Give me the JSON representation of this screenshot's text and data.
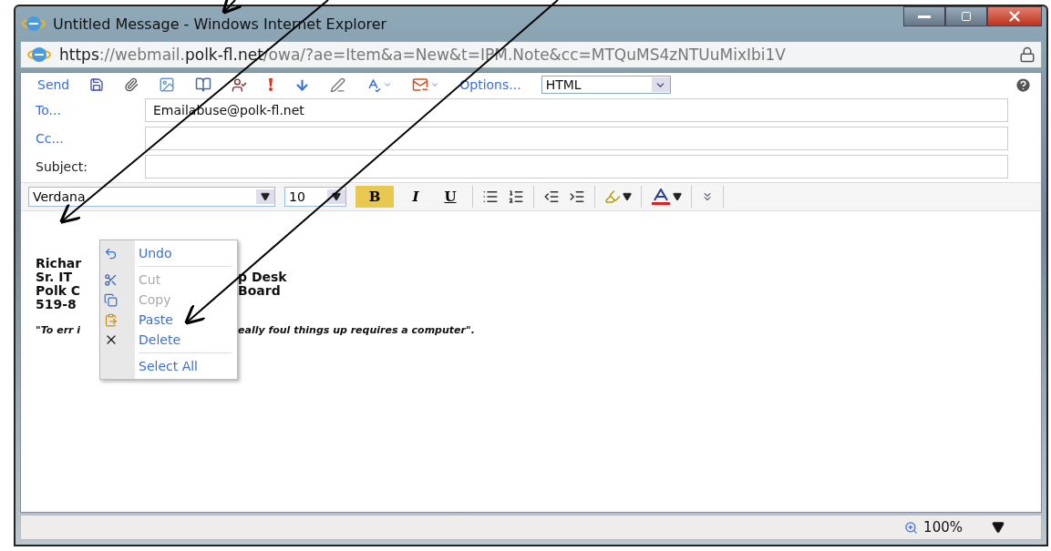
{
  "window": {
    "title": "Untitled Message - Windows Internet Explorer"
  },
  "address_bar": {
    "url_parts": [
      {
        "text": "https",
        "emphasis": true
      },
      {
        "text": "://webmail.",
        "emphasis": false
      },
      {
        "text": "polk-fl.net",
        "emphasis": true
      },
      {
        "text": "/owa/?ae=Item&a=New&t=IPM.Note&cc=MTQuMS4zNTUuMixIbi1V",
        "emphasis": false
      }
    ]
  },
  "toolbar": {
    "send": "Send",
    "options": "Options...",
    "format_select": {
      "value": "HTML"
    }
  },
  "fields": [
    {
      "kind": "link",
      "label": "To...",
      "value": "Emailabuse@polk-fl.net"
    },
    {
      "kind": "link",
      "label": "Cc..."
    },
    {
      "kind": "plain",
      "label": "Subject:"
    }
  ],
  "format_bar": {
    "font": "Verdana",
    "size": "10",
    "buttons": [
      {
        "kind": "bold",
        "label": "B",
        "selected": true
      },
      {
        "kind": "italic",
        "label": "I",
        "selected": false
      },
      {
        "kind": "underline",
        "label": "U",
        "selected": false
      }
    ]
  },
  "body": [
    {
      "kind": "signature",
      "left": "Richar"
    },
    {
      "kind": "signature",
      "left": "Sr. IT",
      "right": "p Desk"
    },
    {
      "kind": "signature",
      "left": "Polk C",
      "right": "Board"
    },
    {
      "kind": "signature",
      "left": "519-8"
    },
    {
      "kind": "quote",
      "left": "\"To err i",
      "right": "eally foul things up requires a computer\"."
    }
  ],
  "context_menu": [
    {
      "kind": "undo",
      "label": "Undo",
      "disabled": false,
      "separator_after": true
    },
    {
      "kind": "cut",
      "label": "Cut",
      "disabled": true,
      "separator_after": false
    },
    {
      "kind": "copy",
      "label": "Copy",
      "disabled": true,
      "separator_after": false
    },
    {
      "kind": "paste",
      "label": "Paste",
      "disabled": false,
      "separator_after": false
    },
    {
      "kind": "delete",
      "label": "Delete",
      "disabled": false,
      "separator_after": true
    },
    {
      "kind": "select",
      "label": "Select All",
      "disabled": false,
      "separator_after": false
    }
  ],
  "status_bar": {
    "zoom": "100%"
  }
}
